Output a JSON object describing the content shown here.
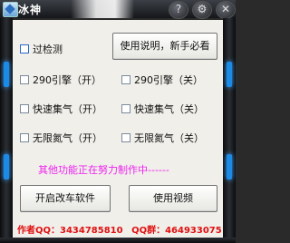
{
  "window": {
    "title": "冰神",
    "buttons": [
      "?",
      "⚙",
      "✕"
    ]
  },
  "options": {
    "detection": "过检测",
    "items": [
      {
        "left": "290引擎（开）",
        "right": "290引擎（关）"
      },
      {
        "left": "快速集气（开）",
        "right": "快速集气（关）"
      },
      {
        "left": "无限氮气（开）",
        "right": "无限氮气（关）"
      }
    ]
  },
  "buttons": {
    "help": "使用说明，新手必看",
    "open_software": "开启改车软件",
    "video": "使用视频"
  },
  "notice": "其他功能正在努力制作中------",
  "footer": {
    "author": "作者QQ：3434785810",
    "group": "QQ群：464933075"
  },
  "colors": {
    "notice": "#ee22ee",
    "footer": "#e01010",
    "led": "#1b8be8"
  }
}
